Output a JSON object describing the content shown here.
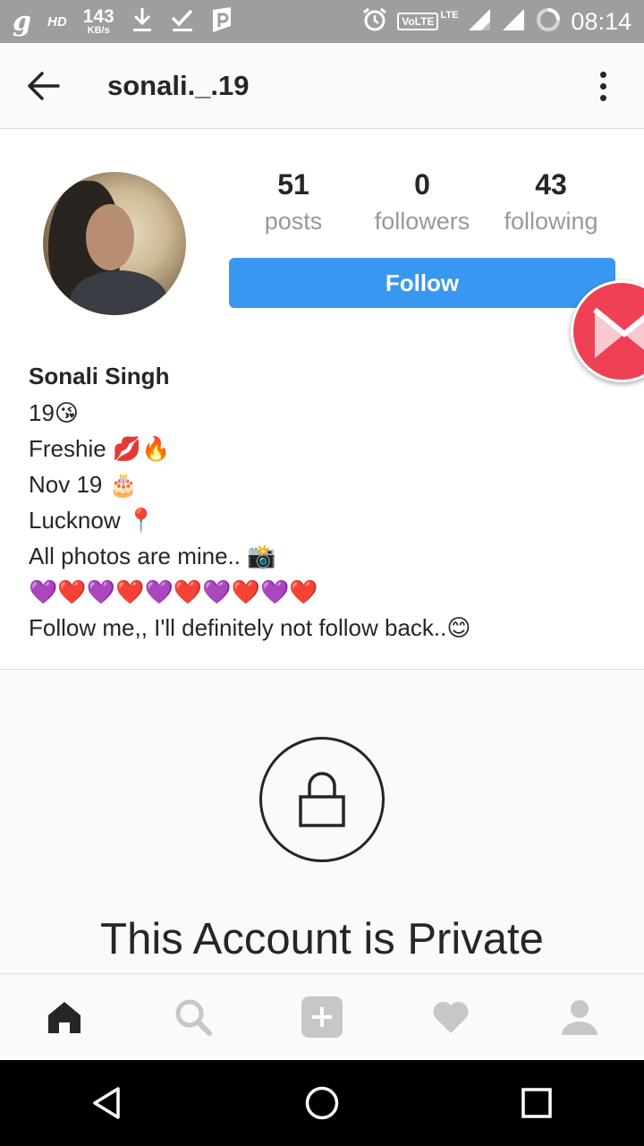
{
  "status_bar": {
    "carrier_icon": "g",
    "hd_label": "HD",
    "speed_value": "143",
    "speed_unit": "KB/s",
    "volte_label": "VoLTE",
    "lte_label": "LTE",
    "time": "08:14",
    "icons": [
      "download-icon",
      "check-icon",
      "parking-app-icon",
      "alarm-icon",
      "signal-icon",
      "signal-icon",
      "battery-ring-icon"
    ]
  },
  "app_bar": {
    "username": "sonali._.19"
  },
  "profile": {
    "stats": [
      {
        "value": "51",
        "label": "posts"
      },
      {
        "value": "0",
        "label": "followers"
      },
      {
        "value": "43",
        "label": "following"
      }
    ],
    "follow_label": "Follow",
    "display_name": "Sonali Singh",
    "bio_lines": [
      "19😘",
      "Freshie 💋🔥",
      "Nov 19 🎂",
      "Lucknow 📍",
      "All photos are mine.. 📸",
      "💜❤️💜❤️💜❤️💜❤️💜❤️",
      "Follow me,, I'll definitely not follow back..😊"
    ]
  },
  "private": {
    "title": "This Account is Private"
  },
  "tab_bar": {
    "tabs": [
      "home-icon",
      "search-icon",
      "add-post-icon",
      "activity-heart-icon",
      "profile-icon"
    ]
  },
  "nav_bar": {
    "buttons": [
      "back-triangle-icon",
      "home-circle-icon",
      "recents-square-icon"
    ]
  },
  "colors": {
    "accent": "#3897f0",
    "status_bar": "#9e9e9e",
    "floating_button": "#ef4055"
  }
}
